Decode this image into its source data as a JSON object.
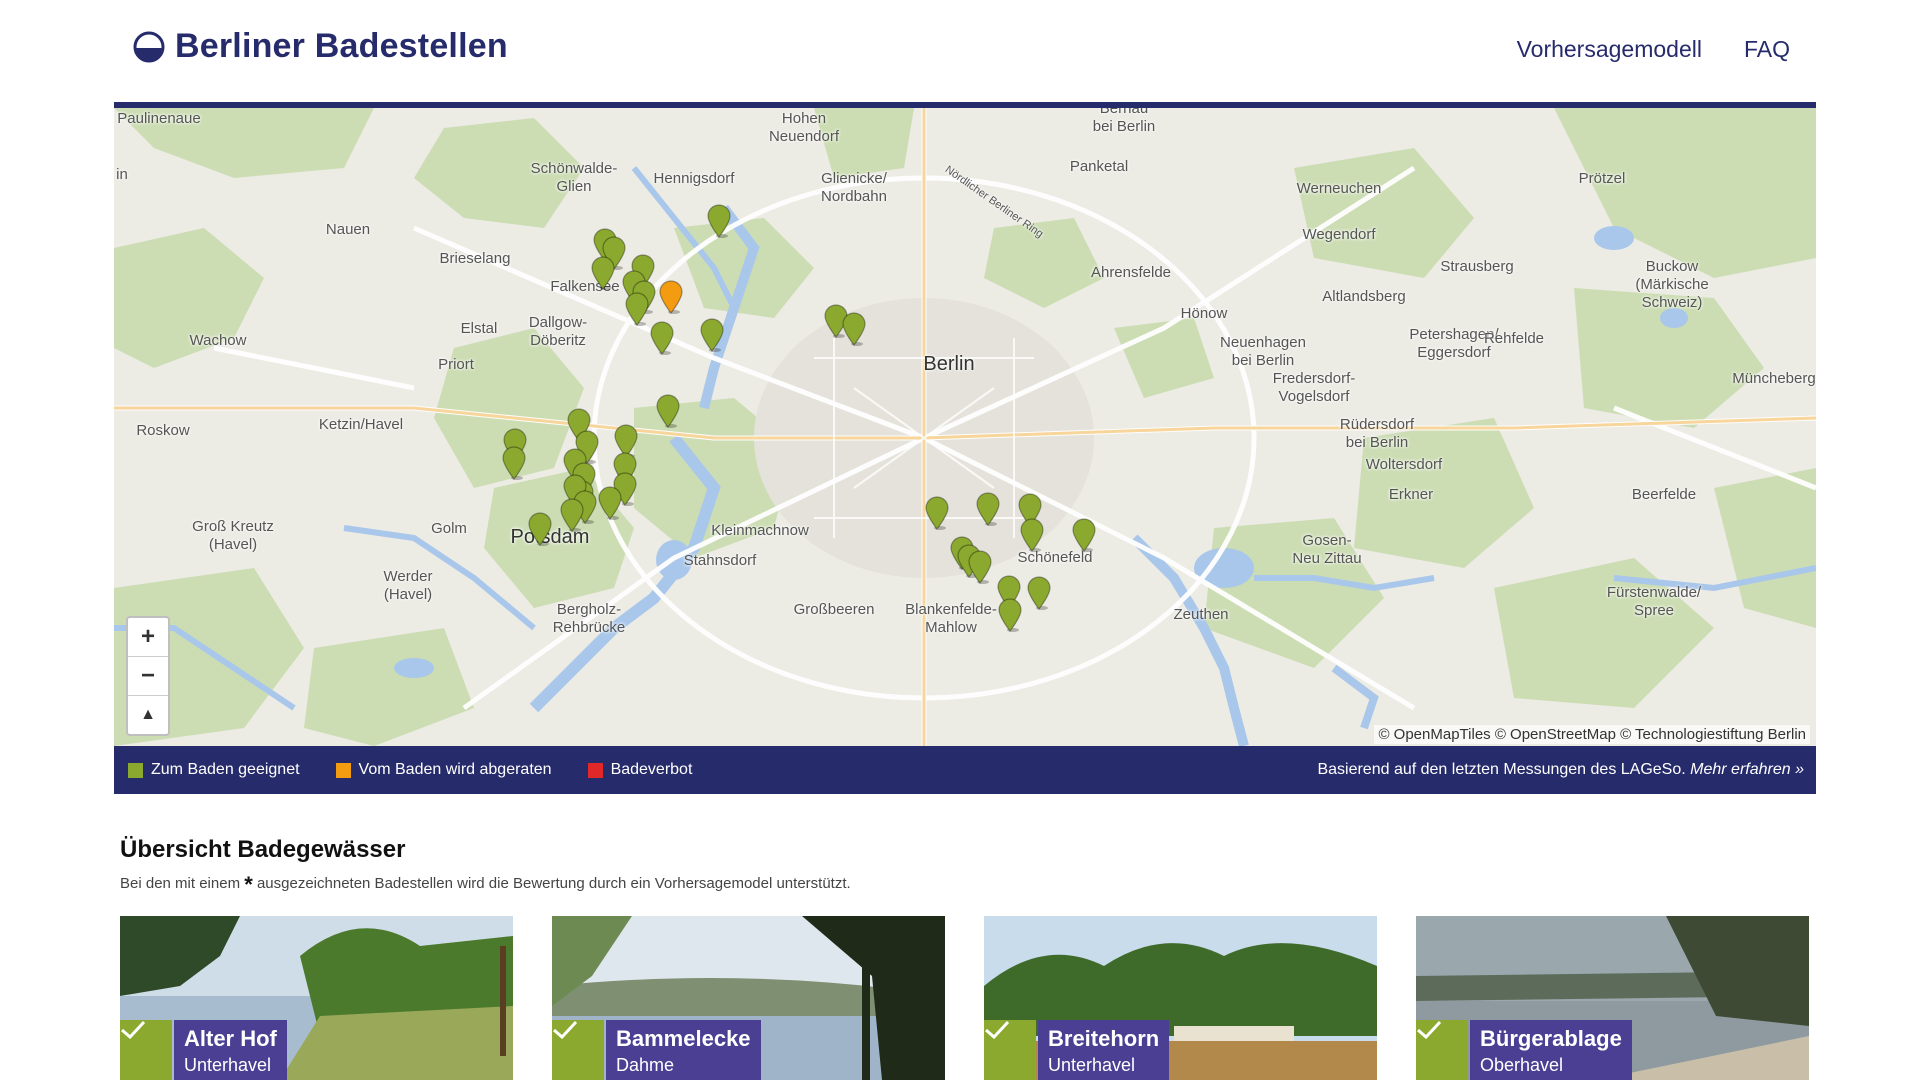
{
  "header": {
    "site_title": "Berliner Badestellen",
    "nav": [
      "Vorhersagemodell",
      "FAQ"
    ]
  },
  "map": {
    "places": [
      {
        "label": "Paulinenaue"
      },
      {
        "label": "Hohen\nNeuendorf"
      },
      {
        "label": "Bernau\nbei Berlin"
      },
      {
        "label": "Schönwalde-\nGlien"
      },
      {
        "label": "Hennigsdorf"
      },
      {
        "label": "Glienicke/\nNordbahn"
      },
      {
        "label": "Panketal"
      },
      {
        "label": "Nördlicher Berliner Ring"
      },
      {
        "label": "Werneuchen"
      },
      {
        "label": "Prötzel"
      },
      {
        "label": "Nauen"
      },
      {
        "label": "Brieselang"
      },
      {
        "label": "Wegendorf"
      },
      {
        "label": "Falkensee"
      },
      {
        "label": "Ahrensfelde"
      },
      {
        "label": "Strausberg"
      },
      {
        "label": "Buckow\n(Märkische\nSchweiz)"
      },
      {
        "label": "Altlandsberg"
      },
      {
        "label": "Elstal"
      },
      {
        "label": "Dallgow-\nDöberitz"
      },
      {
        "label": "Hönow"
      },
      {
        "label": "Wachow"
      },
      {
        "label": "Neuenhagen\nbei Berlin"
      },
      {
        "label": "Petershagen/\nEggersdorf"
      },
      {
        "label": "Rehfelde"
      },
      {
        "label": "Priort"
      },
      {
        "label": "Berlin"
      },
      {
        "label": "Fredersdorf-\nVogelsdorf"
      },
      {
        "label": "Müncheberg"
      },
      {
        "label": "Roskow"
      },
      {
        "label": "Ketzin/Havel"
      },
      {
        "label": "Rüdersdorf\nbei Berlin"
      },
      {
        "label": "Woltersdorf"
      },
      {
        "label": "Erkner"
      },
      {
        "label": "Beerfelde"
      },
      {
        "label": "Groß Kreutz\n(Havel)"
      },
      {
        "label": "Golm"
      },
      {
        "label": "Potsdam"
      },
      {
        "label": "Kleinmachnow"
      },
      {
        "label": "Gosen-\nNeu Zittau"
      },
      {
        "label": "Stahnsdorf"
      },
      {
        "label": "Schönefeld"
      },
      {
        "label": "Werder\n(Havel)"
      },
      {
        "label": "Großbeeren"
      },
      {
        "label": "Blankenfelde-\nMahlow"
      },
      {
        "label": "Fürstenwalde/\nSpree"
      },
      {
        "label": "Bergholz-\nRehbrücke"
      },
      {
        "label": "Zeuthen"
      },
      {
        "label": "in"
      }
    ],
    "attribution": "© OpenMapTiles © OpenStreetMap © Technologiestiftung Berlin",
    "zoom_in": "+",
    "zoom_out": "−",
    "reset": "▲",
    "markers": [
      {
        "status": "green"
      },
      {
        "status": "green"
      },
      {
        "status": "green"
      },
      {
        "status": "green"
      },
      {
        "status": "green"
      },
      {
        "status": "green"
      },
      {
        "status": "green"
      },
      {
        "status": "green"
      },
      {
        "status": "orange"
      },
      {
        "status": "green"
      },
      {
        "status": "green"
      },
      {
        "status": "green"
      },
      {
        "status": "green"
      },
      {
        "status": "green"
      },
      {
        "status": "green"
      },
      {
        "status": "green"
      },
      {
        "status": "green"
      },
      {
        "status": "green"
      },
      {
        "status": "green"
      },
      {
        "status": "green"
      },
      {
        "status": "green"
      },
      {
        "status": "green"
      },
      {
        "status": "green"
      },
      {
        "status": "green"
      },
      {
        "status": "green"
      },
      {
        "status": "green"
      },
      {
        "status": "green"
      },
      {
        "status": "green"
      },
      {
        "status": "green"
      },
      {
        "status": "green"
      },
      {
        "status": "green"
      },
      {
        "status": "green"
      },
      {
        "status": "green"
      },
      {
        "status": "green"
      },
      {
        "status": "green"
      },
      {
        "status": "green"
      },
      {
        "status": "green"
      },
      {
        "status": "green"
      },
      {
        "status": "green"
      },
      {
        "status": "green"
      }
    ]
  },
  "legend": {
    "items": [
      {
        "label": "Zum Baden geeignet",
        "color": "#8aa92e"
      },
      {
        "label": "Vom Baden wird abgeraten",
        "color": "#f39c12"
      },
      {
        "label": "Badeverbot",
        "color": "#e02828"
      }
    ],
    "note": "Basierend auf den letzten Messungen des LAGeSo.",
    "more_link": "Mehr erfahren »"
  },
  "overview": {
    "title": "Übersicht Badegewässer",
    "subtitle_pre": "Bei den mit einem",
    "star": "*",
    "subtitle_post": "ausgezeichneten Badestellen wird die Bewertung durch ein Vorhersagemodel unterstützt."
  },
  "cards": [
    {
      "name": "Alter Hof",
      "region": "Unterhavel",
      "status": "green"
    },
    {
      "name": "Bammelecke",
      "region": "Dahme",
      "status": "green"
    },
    {
      "name": "Breitehorn",
      "region": "Unterhavel",
      "status": "green"
    },
    {
      "name": "Bürgerablage",
      "region": "Oberhavel",
      "status": "green"
    }
  ],
  "colors": {
    "brand": "#262b6b",
    "green": "#8aa92e",
    "orange": "#f39c12",
    "red": "#e02828",
    "card_label": "#4a3f93"
  }
}
